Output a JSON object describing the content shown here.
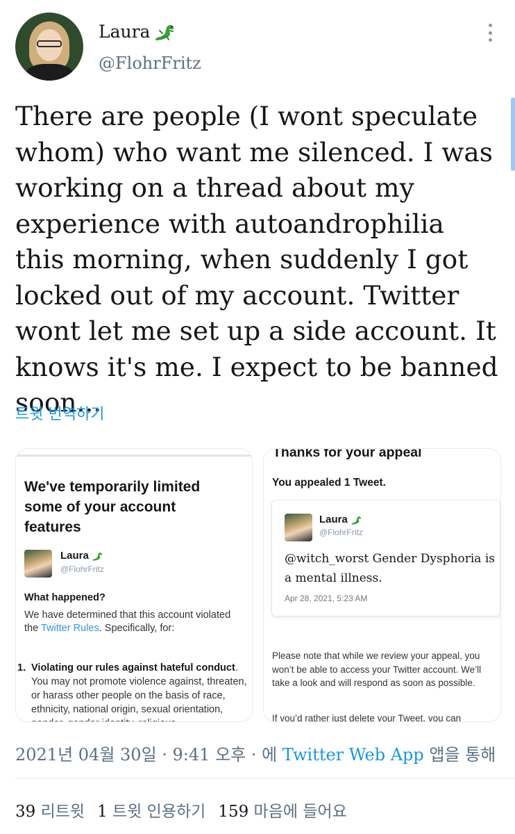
{
  "user": {
    "name": "Laura",
    "handle": "@FlohrFritz"
  },
  "tweet": {
    "text": "There are people (I wont speculate whom) who want me silenced. I was working on a thread about my experience with autoandrophilia this morning, when suddenly I got locked out of my account. Twitter wont let me set up a side account. It knows it's me. I expect to be banned soon...",
    "translate_label": "트윗 번역하기"
  },
  "media": {
    "left": {
      "title": "We've temporarily limited some of your account features",
      "name": "Laura",
      "handle": "@FlohrFritz",
      "what_happened": "What happened?",
      "body_before_link": "We have determined that this account violated the ",
      "body_link": "Twitter Rules",
      "body_after_link": ". Specifically, for:",
      "list_number": "1.",
      "list_bold": "Violating our rules against ",
      "list_link": "hateful conduct",
      "list_rest": ". You may not promote violence against, threaten, or harass other people on the basis of race, ethnicity, national origin, sexual orientation, gender, gender identity, religious"
    },
    "right": {
      "title": "Thanks for your appeal",
      "subtitle": "You appealed 1 Tweet.",
      "quote_name": "Laura",
      "quote_handle": "@FlohrFritz",
      "quote_text": "@witch_worst Gender Dysphoria is a mental illness.",
      "quote_date": "Apr 28, 2021, 5:23 AM",
      "body": "Please note that while we review your appeal, you won’t be able to access your Twitter account. We’ll take a look and will respond as soon as possible.",
      "body2": "If you’d rather just delete your Tweet, you can"
    }
  },
  "meta": {
    "timestamp": "2021년 04월 30일 · 9:41 오후 · 에 ",
    "app": "Twitter Web App",
    "via": " 앱을 통해"
  },
  "stats": {
    "retweets_count": "39",
    "retweets_label": "리트윗",
    "quotes_count": "1",
    "quotes_label": "트윗 인용하기",
    "likes_count": "159",
    "likes_label": "마음에 들어요"
  },
  "colors": {
    "accent": "#1b95e0",
    "secondary_text": "#5b7083",
    "lizard": "#3aa33a"
  },
  "icons": [
    "lizard-emoji-icon",
    "more-options-icon"
  ]
}
